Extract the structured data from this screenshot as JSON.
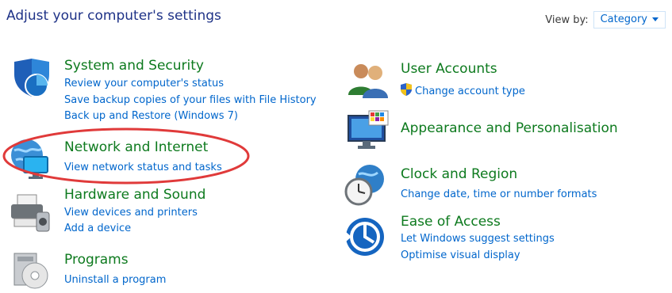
{
  "header": {
    "title": "Adjust your computer's settings"
  },
  "view_by": {
    "label": "View by:",
    "value": "Category"
  },
  "left_categories": [
    {
      "title": "System and Security",
      "links": [
        "Review your computer's status",
        "Save backup copies of your files with File History",
        "Back up and Restore (Windows 7)"
      ],
      "icon": "shield-icon"
    },
    {
      "title": "Network and Internet",
      "links": [
        "View network status and tasks"
      ],
      "icon": "network-globe-icon"
    },
    {
      "title": "Hardware and Sound",
      "links": [
        "View devices and printers",
        "Add a device"
      ],
      "icon": "printer-icon"
    },
    {
      "title": "Programs",
      "links": [
        "Uninstall a program"
      ],
      "icon": "programs-disc-icon"
    }
  ],
  "right_categories": [
    {
      "title": "User Accounts",
      "links": [
        "Change account type"
      ],
      "icon": "users-icon",
      "link_icon": "uac-shield-icon"
    },
    {
      "title": "Appearance and Personalisation",
      "links": [],
      "icon": "monitor-palette-icon"
    },
    {
      "title": "Clock and Region",
      "links": [
        "Change date, time or number formats"
      ],
      "icon": "clock-globe-icon"
    },
    {
      "title": "Ease of Access",
      "links": [
        "Let Windows suggest settings",
        "Optimise visual display"
      ],
      "icon": "ease-of-access-icon"
    }
  ],
  "colors": {
    "title_blue": "#1e3287",
    "category_green": "#0d7a1e",
    "link_blue": "#0066cc",
    "annotation_red": "#e03a3a"
  }
}
